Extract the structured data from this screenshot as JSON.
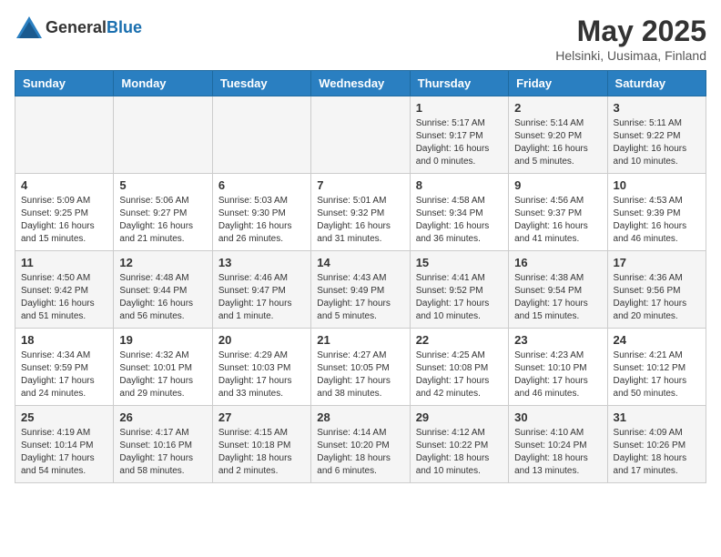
{
  "logo": {
    "general": "General",
    "blue": "Blue"
  },
  "title": "May 2025",
  "subtitle": "Helsinki, Uusimaa, Finland",
  "days_of_week": [
    "Sunday",
    "Monday",
    "Tuesday",
    "Wednesday",
    "Thursday",
    "Friday",
    "Saturday"
  ],
  "weeks": [
    [
      {
        "day": "",
        "info": ""
      },
      {
        "day": "",
        "info": ""
      },
      {
        "day": "",
        "info": ""
      },
      {
        "day": "",
        "info": ""
      },
      {
        "day": "1",
        "info": "Sunrise: 5:17 AM\nSunset: 9:17 PM\nDaylight: 16 hours\nand 0 minutes."
      },
      {
        "day": "2",
        "info": "Sunrise: 5:14 AM\nSunset: 9:20 PM\nDaylight: 16 hours\nand 5 minutes."
      },
      {
        "day": "3",
        "info": "Sunrise: 5:11 AM\nSunset: 9:22 PM\nDaylight: 16 hours\nand 10 minutes."
      }
    ],
    [
      {
        "day": "4",
        "info": "Sunrise: 5:09 AM\nSunset: 9:25 PM\nDaylight: 16 hours\nand 15 minutes."
      },
      {
        "day": "5",
        "info": "Sunrise: 5:06 AM\nSunset: 9:27 PM\nDaylight: 16 hours\nand 21 minutes."
      },
      {
        "day": "6",
        "info": "Sunrise: 5:03 AM\nSunset: 9:30 PM\nDaylight: 16 hours\nand 26 minutes."
      },
      {
        "day": "7",
        "info": "Sunrise: 5:01 AM\nSunset: 9:32 PM\nDaylight: 16 hours\nand 31 minutes."
      },
      {
        "day": "8",
        "info": "Sunrise: 4:58 AM\nSunset: 9:34 PM\nDaylight: 16 hours\nand 36 minutes."
      },
      {
        "day": "9",
        "info": "Sunrise: 4:56 AM\nSunset: 9:37 PM\nDaylight: 16 hours\nand 41 minutes."
      },
      {
        "day": "10",
        "info": "Sunrise: 4:53 AM\nSunset: 9:39 PM\nDaylight: 16 hours\nand 46 minutes."
      }
    ],
    [
      {
        "day": "11",
        "info": "Sunrise: 4:50 AM\nSunset: 9:42 PM\nDaylight: 16 hours\nand 51 minutes."
      },
      {
        "day": "12",
        "info": "Sunrise: 4:48 AM\nSunset: 9:44 PM\nDaylight: 16 hours\nand 56 minutes."
      },
      {
        "day": "13",
        "info": "Sunrise: 4:46 AM\nSunset: 9:47 PM\nDaylight: 17 hours\nand 1 minute."
      },
      {
        "day": "14",
        "info": "Sunrise: 4:43 AM\nSunset: 9:49 PM\nDaylight: 17 hours\nand 5 minutes."
      },
      {
        "day": "15",
        "info": "Sunrise: 4:41 AM\nSunset: 9:52 PM\nDaylight: 17 hours\nand 10 minutes."
      },
      {
        "day": "16",
        "info": "Sunrise: 4:38 AM\nSunset: 9:54 PM\nDaylight: 17 hours\nand 15 minutes."
      },
      {
        "day": "17",
        "info": "Sunrise: 4:36 AM\nSunset: 9:56 PM\nDaylight: 17 hours\nand 20 minutes."
      }
    ],
    [
      {
        "day": "18",
        "info": "Sunrise: 4:34 AM\nSunset: 9:59 PM\nDaylight: 17 hours\nand 24 minutes."
      },
      {
        "day": "19",
        "info": "Sunrise: 4:32 AM\nSunset: 10:01 PM\nDaylight: 17 hours\nand 29 minutes."
      },
      {
        "day": "20",
        "info": "Sunrise: 4:29 AM\nSunset: 10:03 PM\nDaylight: 17 hours\nand 33 minutes."
      },
      {
        "day": "21",
        "info": "Sunrise: 4:27 AM\nSunset: 10:05 PM\nDaylight: 17 hours\nand 38 minutes."
      },
      {
        "day": "22",
        "info": "Sunrise: 4:25 AM\nSunset: 10:08 PM\nDaylight: 17 hours\nand 42 minutes."
      },
      {
        "day": "23",
        "info": "Sunrise: 4:23 AM\nSunset: 10:10 PM\nDaylight: 17 hours\nand 46 minutes."
      },
      {
        "day": "24",
        "info": "Sunrise: 4:21 AM\nSunset: 10:12 PM\nDaylight: 17 hours\nand 50 minutes."
      }
    ],
    [
      {
        "day": "25",
        "info": "Sunrise: 4:19 AM\nSunset: 10:14 PM\nDaylight: 17 hours\nand 54 minutes."
      },
      {
        "day": "26",
        "info": "Sunrise: 4:17 AM\nSunset: 10:16 PM\nDaylight: 17 hours\nand 58 minutes."
      },
      {
        "day": "27",
        "info": "Sunrise: 4:15 AM\nSunset: 10:18 PM\nDaylight: 18 hours\nand 2 minutes."
      },
      {
        "day": "28",
        "info": "Sunrise: 4:14 AM\nSunset: 10:20 PM\nDaylight: 18 hours\nand 6 minutes."
      },
      {
        "day": "29",
        "info": "Sunrise: 4:12 AM\nSunset: 10:22 PM\nDaylight: 18 hours\nand 10 minutes."
      },
      {
        "day": "30",
        "info": "Sunrise: 4:10 AM\nSunset: 10:24 PM\nDaylight: 18 hours\nand 13 minutes."
      },
      {
        "day": "31",
        "info": "Sunrise: 4:09 AM\nSunset: 10:26 PM\nDaylight: 18 hours\nand 17 minutes."
      }
    ]
  ]
}
